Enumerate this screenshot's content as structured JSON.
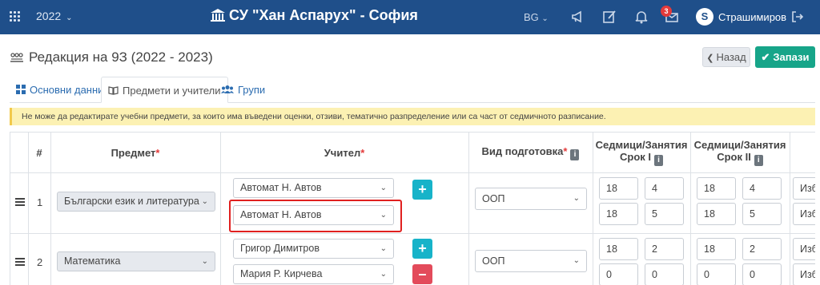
{
  "topbar": {
    "year": "2022",
    "school": "СУ \"Хан Аспарух\" - София",
    "language": "BG",
    "notifications_badge": "3",
    "avatar_letter": "S",
    "user_name": "Страшимиров",
    "bg_color": "#1f4f8a"
  },
  "page": {
    "title": "Редакция на 9З (2022 - 2023)",
    "back_label": "Назад",
    "save_label": "Запази"
  },
  "tabs": [
    {
      "label": "Основни данни",
      "icon": "table-icon"
    },
    {
      "label": "Предмети и учители",
      "icon": "book-icon"
    },
    {
      "label": "Групи",
      "icon": "users-icon"
    }
  ],
  "alert": "Не може да редактирате учебни предмети, за които има въведени оценки, отзиви, тематично разпределение или са част от седмичното разписание.",
  "table": {
    "headers": {
      "num": "#",
      "subject": "Предмет",
      "teacher": "Учител",
      "prep": "Вид подготовка",
      "term1_a": "Седмици/Занятия",
      "term1_b": "Срок I",
      "term2_a": "Седмици/Занятия",
      "term2_b": "Срок II",
      "required_mark": "*"
    },
    "rows": [
      {
        "num": "1",
        "subject": "Български език и литература",
        "teachers": [
          "Автомат Н. Автов",
          "Автомат Н. Автов"
        ],
        "prep": "ООП",
        "term1": [
          [
            "18",
            "4"
          ],
          [
            "18",
            "5"
          ]
        ],
        "term2": [
          [
            "18",
            "4"
          ],
          [
            "18",
            "5"
          ]
        ],
        "extra": [
          "Изб",
          "Изб"
        ]
      },
      {
        "num": "2",
        "subject": "Математика",
        "teachers": [
          "Григор Димитров",
          "Мария Р. Кирчева"
        ],
        "prep": "ООП",
        "term1": [
          [
            "18",
            "2"
          ],
          [
            "0",
            "0"
          ]
        ],
        "term2": [
          [
            "18",
            "2"
          ],
          [
            "0",
            "0"
          ]
        ],
        "extra": [
          "Изб",
          "Изб"
        ]
      }
    ]
  },
  "colors": {
    "accent": "#17a589",
    "add": "#17b3c9",
    "remove": "#e34b5b",
    "highlight": "#e0201f",
    "alert_bg": "#fcf1b3"
  }
}
